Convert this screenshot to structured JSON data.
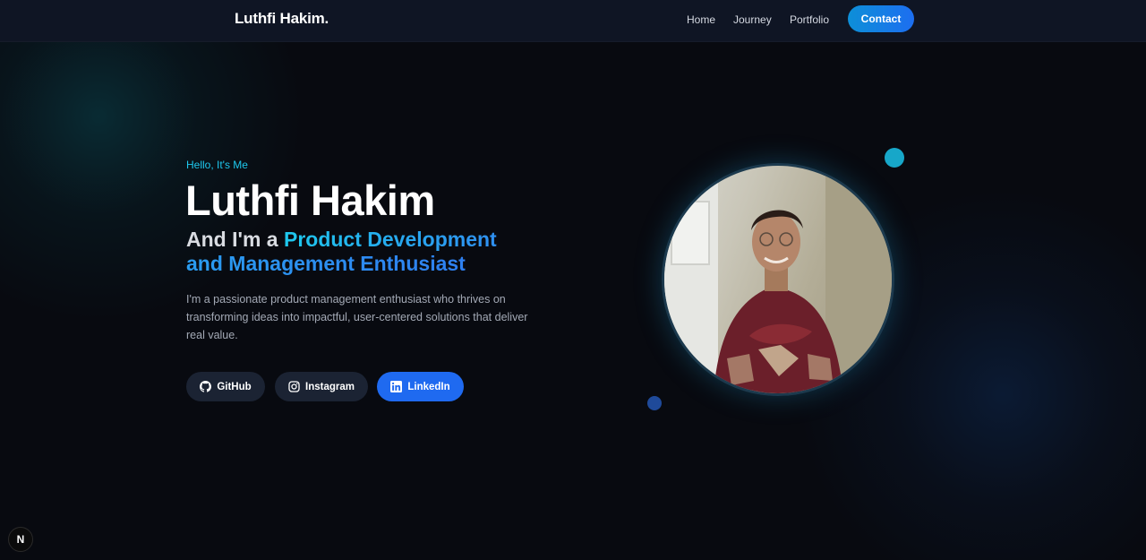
{
  "nav": {
    "brand": "Luthfi Hakim.",
    "links": [
      "Home",
      "Journey",
      "Portfolio"
    ],
    "contact_label": "Contact"
  },
  "hero": {
    "greeting": "Hello, It's Me",
    "name": "Luthfi Hakim",
    "tagline_prefix": "And I'm a ",
    "tagline_highlight_line1": "Product Development",
    "tagline_highlight_line2": "and Management Enthusiast",
    "bio": "I'm a passionate product management enthusiast who thrives on transforming ideas into impactful, user-centered solutions that deliver real value."
  },
  "social": [
    {
      "label": "GitHub",
      "icon": "github-icon"
    },
    {
      "label": "Instagram",
      "icon": "instagram-icon"
    },
    {
      "label": "LinkedIn",
      "icon": "linkedin-icon"
    }
  ],
  "badge": {
    "label": "N"
  },
  "colors": {
    "accent_cyan": "#1ec8ee",
    "accent_blue": "#1f6af0",
    "background": "#080a10",
    "navbar": "#0f1524"
  }
}
